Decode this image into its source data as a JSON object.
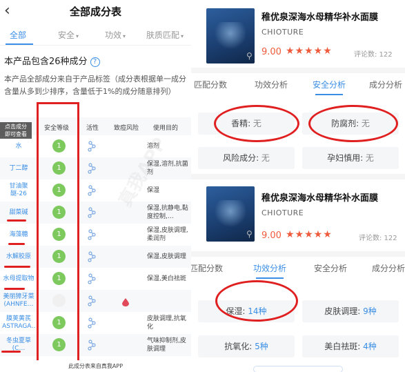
{
  "left": {
    "back_icon": "chevron-left-icon",
    "title": "全部成分表",
    "tabs": [
      {
        "label": "全部",
        "caret": ""
      },
      {
        "label": "安全",
        "caret": "▾"
      },
      {
        "label": "功效",
        "caret": "▾"
      },
      {
        "label": "肤质匹配",
        "caret": "▾"
      }
    ],
    "count_text": "本产品包含26种成分",
    "help_icon": "?",
    "description": "本产品全部成分来自于产品标签（成分表根据单一成分含量从多到少排序，含量低于1%的成分随意排列）",
    "tooltip": "点击成分\n即可查看",
    "headers": {
      "safety": "安全等级",
      "activity": "活性",
      "acne": "致痘风险",
      "purpose": "使用目的"
    },
    "rows": [
      {
        "name": "水",
        "safety": "1",
        "purpose": "溶剂"
      },
      {
        "name": "丁二醇",
        "safety": "1",
        "purpose": "保湿,溶剂,抗菌剂"
      },
      {
        "name": "甘油聚醚-26",
        "safety": "1",
        "purpose": "保湿"
      },
      {
        "name": "甜菜碱",
        "safety": "1",
        "purpose": "保湿,抗静电,黏度控制,…"
      },
      {
        "name": "海藻糖",
        "safety": "1",
        "purpose": "保湿,皮肤调理,柔润剂"
      },
      {
        "name": "水解胶原",
        "safety": "1",
        "purpose": "保湿,皮肤调理"
      },
      {
        "name": "水母提取物",
        "safety": "1",
        "purpose": "保湿,美白祛斑"
      },
      {
        "name": "美丽獐牙菜(AHNFE…",
        "safety": "",
        "purpose": ""
      },
      {
        "name": "膜荚黄芪(ASTRAGA…",
        "safety": "1",
        "purpose": "皮肤调理,抗氧化"
      },
      {
        "name": "冬虫夏草(C…",
        "safety": "1",
        "purpose": "气味抑制剂,皮肤调理"
      }
    ],
    "footer": "此成分表来自真我APP",
    "watermark": "真我APP"
  },
  "right": {
    "top": {
      "title": "稚优泉深海水母精华补水面膜",
      "brand": "CHIOTURE",
      "score": "9.00",
      "stars": "★★★★★",
      "review_count": "评论数: 122",
      "tabs": [
        "匹配分数",
        "功效分析",
        "安全分析",
        "成分分析"
      ],
      "active_tab": 2,
      "chips": [
        {
          "label": "香精: ",
          "value": "无"
        },
        {
          "label": "防腐剂: ",
          "value": "无"
        },
        {
          "label": "风险成分: ",
          "value": "无"
        },
        {
          "label": "孕妇慎用: ",
          "value": "无"
        }
      ]
    },
    "bottom": {
      "title": "稚优泉深海水母精华补水面膜",
      "brand": "CHIOTURE",
      "score": "9.00",
      "stars": "★★★★★",
      "review_count": "评论数: 122",
      "tabs": [
        "匹配分数",
        "功效分析",
        "安全分析",
        "成分分析"
      ],
      "active_tab": 1,
      "chips": [
        {
          "label": "保湿: ",
          "value": "14种"
        },
        {
          "label": "皮肤调理: ",
          "value": "9种"
        },
        {
          "label": "抗氧化: ",
          "value": "5种"
        },
        {
          "label": "美白祛斑: ",
          "value": "4种"
        }
      ]
    }
  },
  "colors": {
    "accent": "#3a8ee6",
    "safe_green": "#7dc95e",
    "annotation_red": "#e02020",
    "score_red": "#f05a3c"
  }
}
